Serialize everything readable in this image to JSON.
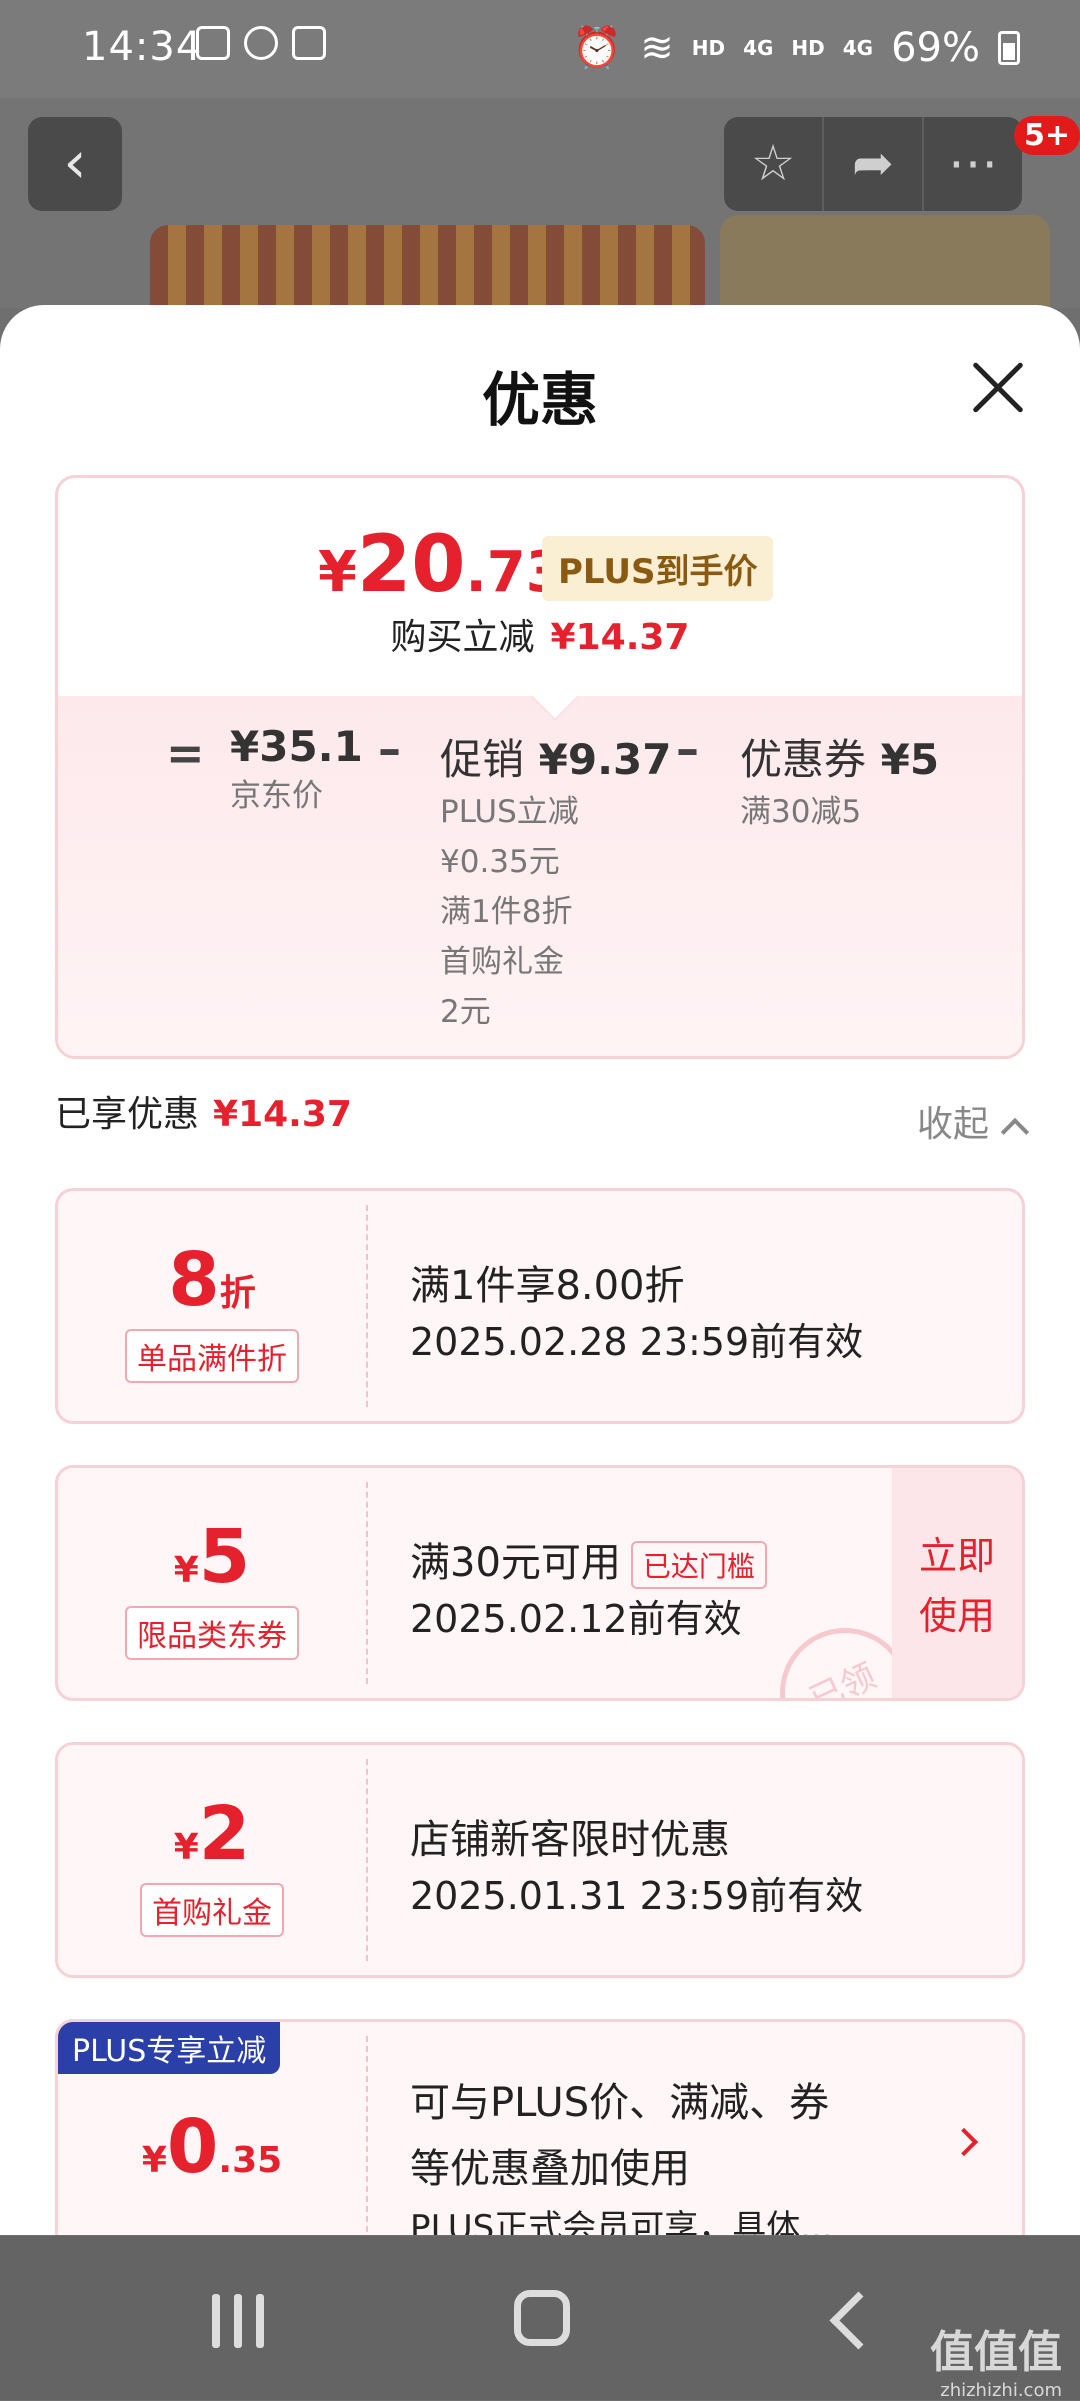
{
  "status_bar": {
    "time": "14:34",
    "network_left": "HD",
    "network_left_sub": "4G",
    "network_right": "HD",
    "network_right_sub": "4G",
    "battery": "69%"
  },
  "top_bar": {
    "badge": "5+"
  },
  "sheet": {
    "title": "优惠"
  },
  "price_summary": {
    "yen": "¥",
    "price_int": "20",
    "price_dec": ".73",
    "plus_tag": "PLUS到手价",
    "save_label": "购买立减",
    "save_amount": "¥14.37",
    "equals": "=",
    "minus": "–",
    "jd_price": "¥35.1",
    "jd_label": "京东价",
    "promo_label": "促销",
    "promo_amount": "¥9.37",
    "promo_details": [
      "PLUS立减",
      "¥0.35元",
      "满1件8折",
      "首购礼金",
      "2元"
    ],
    "coupon_label": "优惠券",
    "coupon_amount": "¥5",
    "coupon_detail": "满30减5"
  },
  "enjoyed": {
    "label": "已享优惠",
    "amount": "¥14.37",
    "collapse": "收起"
  },
  "coupons": [
    {
      "amount_num": "8",
      "amount_unit": "折",
      "tag": "单品满件折",
      "line1": "满1件享8.00折",
      "line2": "2025.02.28 23:59前有效"
    },
    {
      "amount_prefix": "¥",
      "amount_num": "5",
      "tag": "限品类东券",
      "line1": "满30元可用",
      "line1_tag": "已达门槛",
      "line2": "2025.02.12前有效",
      "use_btn": "立即\n使用",
      "use_btn_1": "立即",
      "use_btn_2": "使用",
      "stamp": "已领"
    },
    {
      "amount_prefix": "¥",
      "amount_num": "2",
      "tag": "首购礼金",
      "line1": "店铺新客限时优惠",
      "line2": "2025.01.31 23:59前有效"
    },
    {
      "label": "PLUS专享立减",
      "amount_prefix": "¥",
      "amount_num": "0",
      "amount_dec": ".35",
      "line1": "可与PLUS价、满减、券",
      "line2": "等优惠叠加使用",
      "line3": "PLUS正式会员可享，具体..."
    }
  ],
  "watermark": {
    "text": "值值值",
    "url": "zhizhizhi.com"
  },
  "colors": {
    "accent_red": "#e4212c",
    "plus_blue": "#2b3fa8",
    "plus_gold_bg": "#fbefd3"
  },
  "icons": [
    "back-arrow-icon",
    "star-icon",
    "share-icon",
    "more-icon",
    "close-icon",
    "chevron-up-icon",
    "chevron-right-icon"
  ]
}
